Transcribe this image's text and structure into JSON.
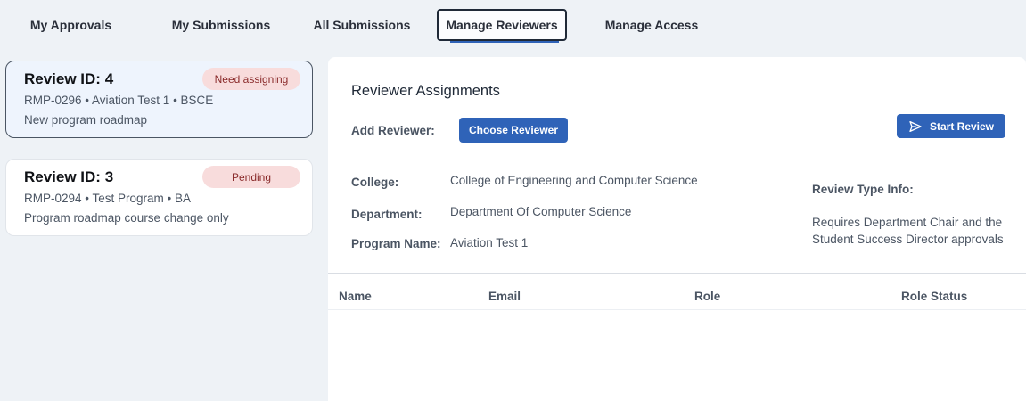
{
  "tabs": [
    {
      "label": "My Approvals"
    },
    {
      "label": "My Submissions"
    },
    {
      "label": "All Submissions"
    },
    {
      "label": "Manage Reviewers",
      "active": true
    },
    {
      "label": "Manage Access"
    }
  ],
  "reviews": [
    {
      "title": "Review ID: 4",
      "line1": "RMP-0296 • Aviation Test 1 • BSCE",
      "line2": "New program roadmap",
      "status": "Need assigning",
      "selected": true
    },
    {
      "title": "Review ID: 3",
      "line1": "RMP-0294 • Test Program • BA",
      "line2": "Program roadmap course change only",
      "status": "Pending",
      "selected": false
    }
  ],
  "panel": {
    "title": "Reviewer Assignments",
    "add_reviewer_label": "Add Reviewer:",
    "choose_reviewer_button": "Choose Reviewer",
    "start_review_button": "Start Review",
    "start_review_icon": "send-icon",
    "college_label": "College:",
    "college_value": "College of Engineering and Computer Science",
    "department_label": "Department:",
    "department_value": "Department Of Computer Science",
    "program_label": "Program Name:",
    "program_value": "Aviation Test 1",
    "review_type_label": "Review Type Info:",
    "review_type_line1": "Requires Department Chair and the",
    "review_type_line2": "Student Success Director approvals"
  },
  "table": {
    "columns": [
      "Name",
      "Email",
      "Role",
      "Role Status"
    ],
    "rows": []
  },
  "colors": {
    "primary": "#2f63b8",
    "badge_bg": "#f8dcdc",
    "badge_text": "#8a2b2b",
    "selected_card_bg": "#eef4fd"
  }
}
